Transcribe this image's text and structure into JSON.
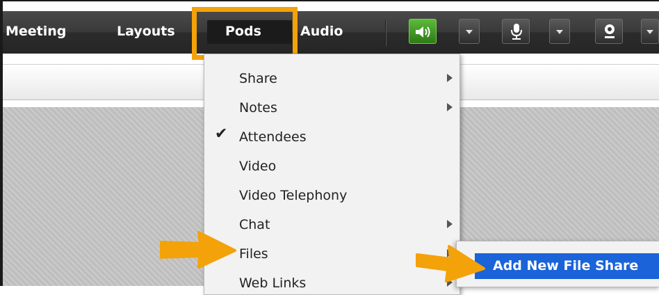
{
  "menubar": {
    "items": [
      {
        "label": "Meeting"
      },
      {
        "label": "Layouts"
      },
      {
        "label": "Pods"
      },
      {
        "label": "Audio"
      }
    ],
    "icons": [
      "speaker-icon",
      "microphone-icon",
      "webcam-icon"
    ]
  },
  "pods_menu": {
    "items": [
      {
        "label": "Share",
        "submenu": true
      },
      {
        "label": "Notes",
        "submenu": true
      },
      {
        "label": "Attendees",
        "checked": true
      },
      {
        "label": "Video"
      },
      {
        "label": "Video Telephony"
      },
      {
        "label": "Chat",
        "submenu": true
      },
      {
        "label": "Files",
        "submenu": true
      },
      {
        "label": "Web Links",
        "submenu": true
      }
    ]
  },
  "files_submenu": {
    "items": [
      {
        "label": "Add New File Share"
      }
    ]
  },
  "colors": {
    "highlight": "#f3a20a",
    "selection": "#1a63d9",
    "speaker_active": "#4fb82f"
  }
}
